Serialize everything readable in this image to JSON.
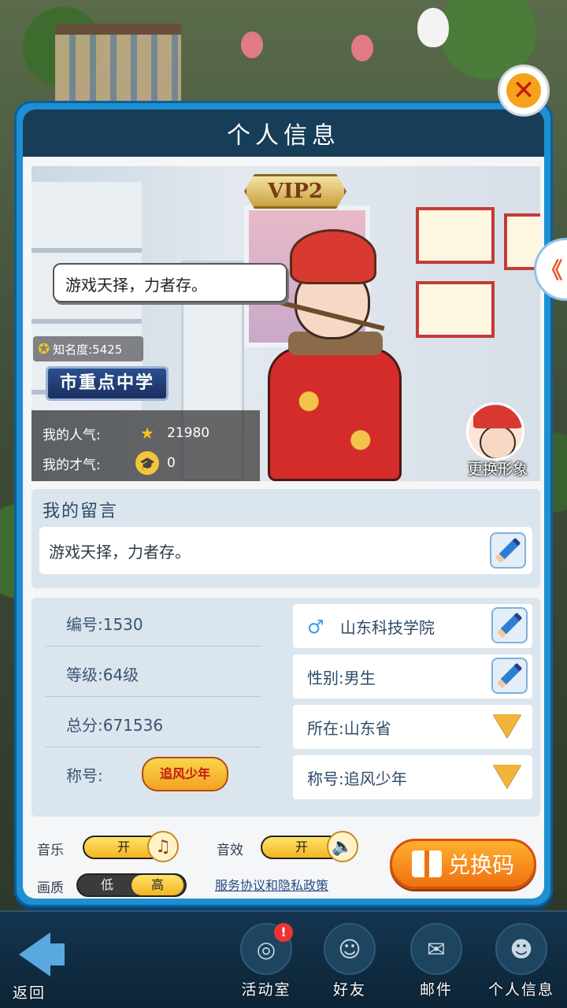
{
  "header": {
    "title": "个人信息"
  },
  "close_symbol": "✕",
  "side_tab_symbol": "《",
  "scene": {
    "vip": "VIP2",
    "speech": "游戏天择，力者存。",
    "fame_label": "知名度:5425",
    "school": "市重点中学",
    "popularity_label": "我的人气:",
    "popularity_value": "21980",
    "talent_label": "我的才气:",
    "talent_value": "0",
    "change_avatar": "更换形象"
  },
  "message": {
    "title": "我的留言",
    "text": "游戏天择，力者存。"
  },
  "info": {
    "id": "编号:1530",
    "level": "等级:64级",
    "score": "总分:671536",
    "title_label": "称号:",
    "title_emblem": "追风少年",
    "school": "山东科技学院",
    "gender": "性别:男生",
    "location": "所在:山东省",
    "title_select": "称号:追风少年"
  },
  "settings": {
    "music_label": "音乐",
    "music_state": "开",
    "sound_label": "音效",
    "sound_state": "开",
    "quality_label": "画质",
    "quality_low": "低",
    "quality_high": "高",
    "quality_selected": "高",
    "policy_link": "服务协议和隐私政策",
    "redeem": "兑换码"
  },
  "nav": {
    "back": "返回",
    "items": [
      "活动室",
      "好友",
      "邮件",
      "个人信息"
    ]
  },
  "colors": {
    "panel_border": "#1d8fd3",
    "title_bar": "#173e58",
    "accent_orange": "#f07010",
    "toggle_yellow": "#f2b520"
  }
}
